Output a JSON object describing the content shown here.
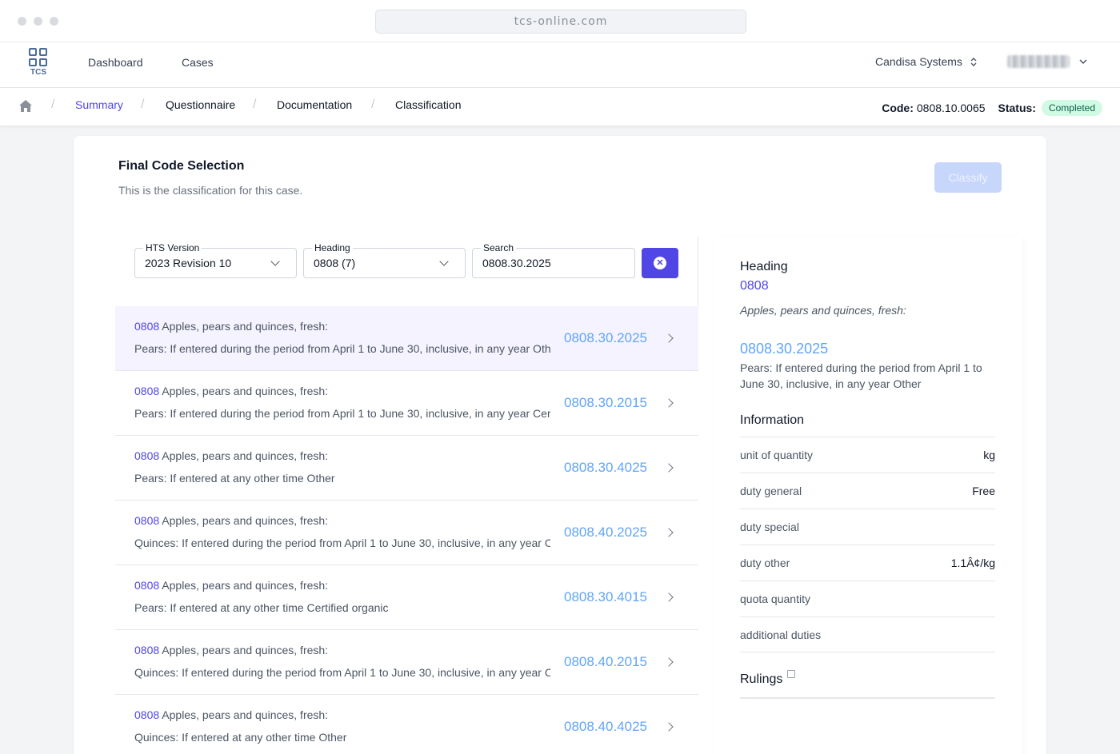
{
  "browser": {
    "url": "tcs-online.com"
  },
  "nav": {
    "logo_text": "TCS",
    "links": [
      "Dashboard",
      "Cases"
    ],
    "organization": "Candisa Systems"
  },
  "breadcrumbs": [
    "Summary",
    "Questionnaire",
    "Documentation",
    "Classification"
  ],
  "case": {
    "code_label": "Code:",
    "code": "0808.10.0065",
    "status_label": "Status:",
    "status": "Completed"
  },
  "card": {
    "title": "Final Code Selection",
    "subtitle": "This is the classification for this case.",
    "classify_label": "Classify"
  },
  "filters": {
    "hts_version": {
      "label": "HTS Version",
      "value": "2023 Revision 10"
    },
    "heading": {
      "label": "Heading",
      "value": "0808 (7)"
    },
    "search": {
      "label": "Search",
      "value": "0808.30.2025"
    }
  },
  "results": [
    {
      "heading": "0808",
      "heading_desc": "Apples, pears and quinces, fresh:",
      "desc": "Pears: If entered during the period from April 1 to June 30, inclusive, in any year Other",
      "code": "0808.30.2025",
      "selected": true
    },
    {
      "heading": "0808",
      "heading_desc": "Apples, pears and quinces, fresh:",
      "desc": "Pears: If entered during the period from April 1 to June 30, inclusive, in any year Certified organic",
      "code": "0808.30.2015",
      "selected": false
    },
    {
      "heading": "0808",
      "heading_desc": "Apples, pears and quinces, fresh:",
      "desc": "Pears: If entered at any other time Other",
      "code": "0808.30.4025",
      "selected": false
    },
    {
      "heading": "0808",
      "heading_desc": "Apples, pears and quinces, fresh:",
      "desc": "Quinces: If entered during the period from April 1 to June 30, inclusive, in any year Other",
      "code": "0808.40.2025",
      "selected": false
    },
    {
      "heading": "0808",
      "heading_desc": "Apples, pears and quinces, fresh:",
      "desc": "Pears: If entered at any other time Certified organic",
      "code": "0808.30.4015",
      "selected": false
    },
    {
      "heading": "0808",
      "heading_desc": "Apples, pears and quinces, fresh:",
      "desc": "Quinces: If entered during the period from April 1 to June 30, inclusive, in any year Certified organic",
      "code": "0808.40.2015",
      "selected": false
    },
    {
      "heading": "0808",
      "heading_desc": "Apples, pears and quinces, fresh:",
      "desc": "Quinces: If entered at any other time Other",
      "code": "0808.40.4025",
      "selected": false
    }
  ],
  "detail": {
    "heading_label": "Heading",
    "heading_code": "0808",
    "heading_desc": "Apples, pears and quinces, fresh:",
    "code": "0808.30.2025",
    "code_desc": "Pears: If entered during the period from April 1 to June 30, inclusive, in any year Other",
    "info_title": "Information",
    "info": [
      {
        "key": "unit of quantity",
        "value": "kg"
      },
      {
        "key": "duty general",
        "value": "Free"
      },
      {
        "key": "duty special",
        "value": ""
      },
      {
        "key": "duty other",
        "value": "1.1Â¢/kg"
      },
      {
        "key": "quota quantity",
        "value": ""
      },
      {
        "key": "additional duties",
        "value": ""
      }
    ],
    "rulings_label": "Rulings"
  }
}
